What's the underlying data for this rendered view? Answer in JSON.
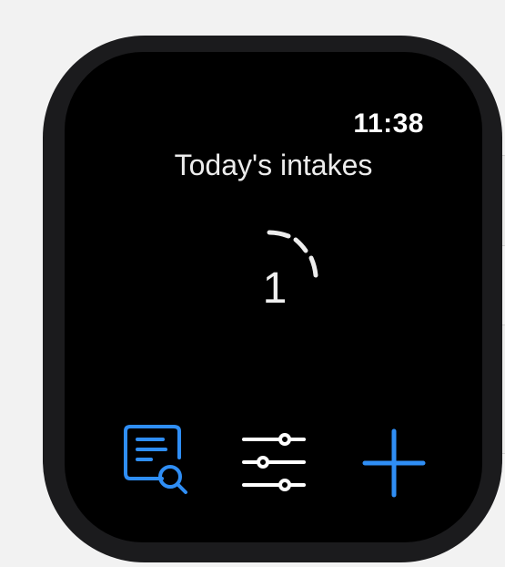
{
  "status_bar": {
    "time": "11:38"
  },
  "main": {
    "title": "Today's intakes",
    "intake_count": "1",
    "progress_ring": {
      "segments_filled": 2
    }
  },
  "actions": [
    {
      "name": "history",
      "icon": "document-search-icon",
      "color": "#2f8ef5"
    },
    {
      "name": "settings",
      "icon": "sliders-icon",
      "color": "#ffffff"
    },
    {
      "name": "add",
      "icon": "plus-icon",
      "color": "#2f8ef5"
    }
  ],
  "theme": {
    "screen_background": "#000000",
    "accent": "#2f8ef5"
  }
}
